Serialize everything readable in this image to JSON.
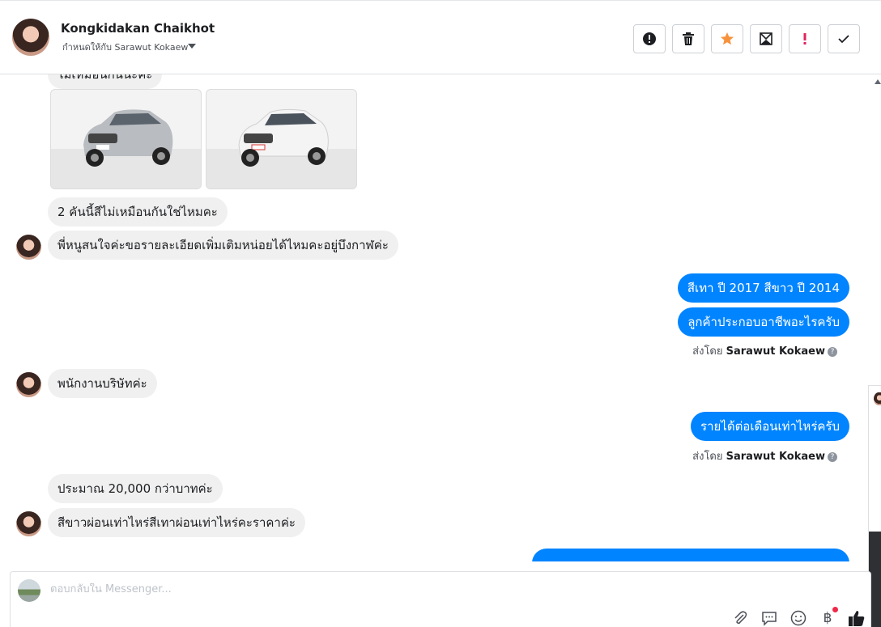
{
  "header": {
    "contact_name": "Kongkidakan Chaikhot",
    "assigned_to": "กำหนดให้กับ Sarawut Kokaew"
  },
  "toolbar": {
    "buttons": [
      {
        "icon": "alert-circle-icon"
      },
      {
        "icon": "trash-icon"
      },
      {
        "icon": "star-icon",
        "color": "#f7923b"
      },
      {
        "icon": "mark-unread-icon"
      },
      {
        "icon": "exclamation-icon",
        "color": "#e0245e"
      },
      {
        "icon": "checkmark-icon"
      }
    ]
  },
  "messages": {
    "partial_top": "ไม่เหมือนกันนะคะ",
    "m1": "2 คันนี้สีไม่เหมือนกันใช่ไหมคะ",
    "m2": "พี่หนูสนใจค่ะขอรายละเอียดเพิ่มเติมหน่อยได้ไหมคะอยู่บึงกาฬค่ะ",
    "m3": "สีเทา ปี 2017 สีขาว ปี 2014",
    "m4": "ลูกค้าประกอบอาชีพอะไรครับ",
    "m5": "พนักงานบริษัทค่ะ",
    "m6": "รายได้ต่อเดือนเท่าไหร่ครับ",
    "m7": "ประมาณ 20,000 กว่าบาทค่ะ",
    "m8": "สีขาวผ่อนเท่าไหร่สีเทาผ่อนเท่าไหร่คะราคาค่ะ"
  },
  "sent_by": {
    "prefix": "ส่งโดย",
    "name": "Sarawut Kokaew"
  },
  "composer": {
    "placeholder": "ตอบกลับใน Messenger..."
  },
  "colors": {
    "outgoing": "#0084ff",
    "incoming": "#f0f0f0",
    "like": "#1c1e21"
  }
}
